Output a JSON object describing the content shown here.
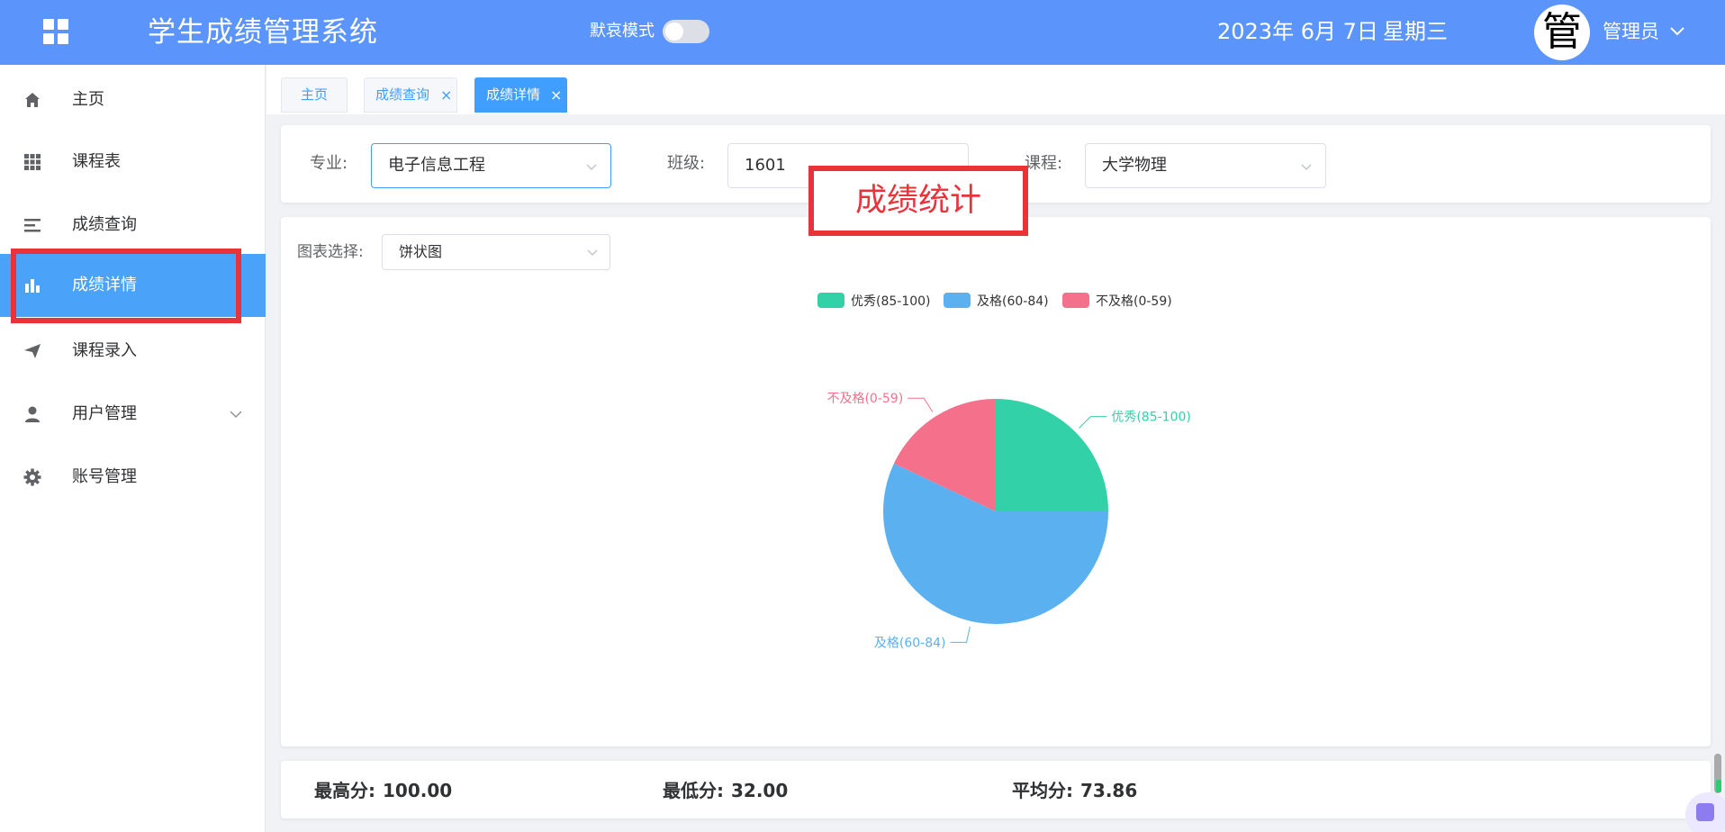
{
  "header": {
    "title": "学生成绩管理系统",
    "mode_label": "默哀模式",
    "date": "2023年 6月 7日",
    "weekday": "星期三",
    "avatar_char": "管",
    "user_name": "管理员",
    "brand_color": "#5b95fc"
  },
  "sidebar": {
    "items": [
      {
        "label": "主页",
        "icon": "home-icon"
      },
      {
        "label": "课程表",
        "icon": "grid-icon"
      },
      {
        "label": "成绩查询",
        "icon": "list-icon"
      },
      {
        "label": "成绩详情",
        "icon": "bar-chart-icon",
        "active": true
      },
      {
        "label": "课程录入",
        "icon": "send-icon"
      },
      {
        "label": "用户管理",
        "icon": "user-icon",
        "has_submenu": true
      },
      {
        "label": "账号管理",
        "icon": "gear-icon"
      }
    ],
    "active_color": "#4aa3f8"
  },
  "tabs": [
    {
      "label": "主页",
      "closable": false
    },
    {
      "label": "成绩查询",
      "closable": true,
      "close": "×"
    },
    {
      "label": "成绩详情",
      "closable": true,
      "close": "×",
      "active": true
    }
  ],
  "filters": {
    "major_label": "专业:",
    "major_value": "电子信息工程",
    "class_label": "班级:",
    "class_value": "1601",
    "course_label": "课程:",
    "course_value": "大学物理"
  },
  "overlay_label": "成绩统计",
  "chart_panel": {
    "select_label": "图表选择:",
    "select_value": "饼状图"
  },
  "chart_data": {
    "type": "pie",
    "labels": [
      "优秀(85-100)",
      "及格(60-84)",
      "不及格(0-59)"
    ],
    "values": [
      25,
      57,
      18
    ],
    "colors": [
      "#33d1a8",
      "#5bb1ef",
      "#f5718b"
    ],
    "legend_position": "top-center"
  },
  "summary": {
    "max_label": "最高分:",
    "max_value": "100.00",
    "min_label": "最低分:",
    "min_value": "32.00",
    "avg_label": "平均分:",
    "avg_value": "73.86"
  }
}
